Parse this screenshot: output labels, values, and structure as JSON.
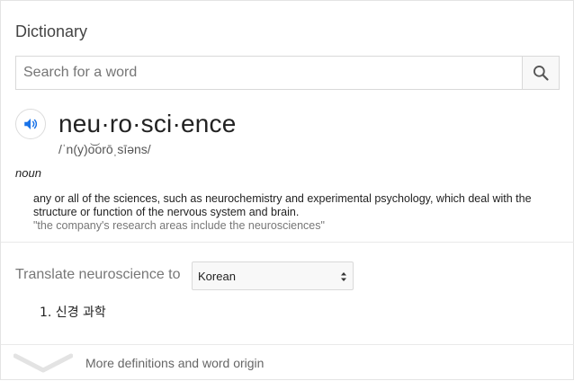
{
  "header": {
    "title": "Dictionary"
  },
  "search": {
    "placeholder": "Search for a word",
    "value": ""
  },
  "entry": {
    "word": "neu·ro·sci·ence",
    "pronunciation": "/ˈn(y)o͝orōˌsīəns/",
    "part_of_speech": "noun",
    "definition": "any or all of the sciences, such as neurochemistry and experimental psychology, which deal with the structure or function of the nervous system and brain.",
    "example": "\"the company's research areas include the neurosciences\""
  },
  "translate": {
    "label": "Translate neuroscience to",
    "selected_language": "Korean",
    "results": [
      "1. 신경 과학"
    ]
  },
  "footer": {
    "more_label": "More definitions and word origin"
  },
  "colors": {
    "accent": "#1a73e8",
    "muted": "#777777",
    "border": "#d9d9d9"
  },
  "icons": {
    "search": "search-icon",
    "speaker": "speaker-icon",
    "expand": "chevron-down-icon",
    "select": "select-arrows-icon"
  }
}
